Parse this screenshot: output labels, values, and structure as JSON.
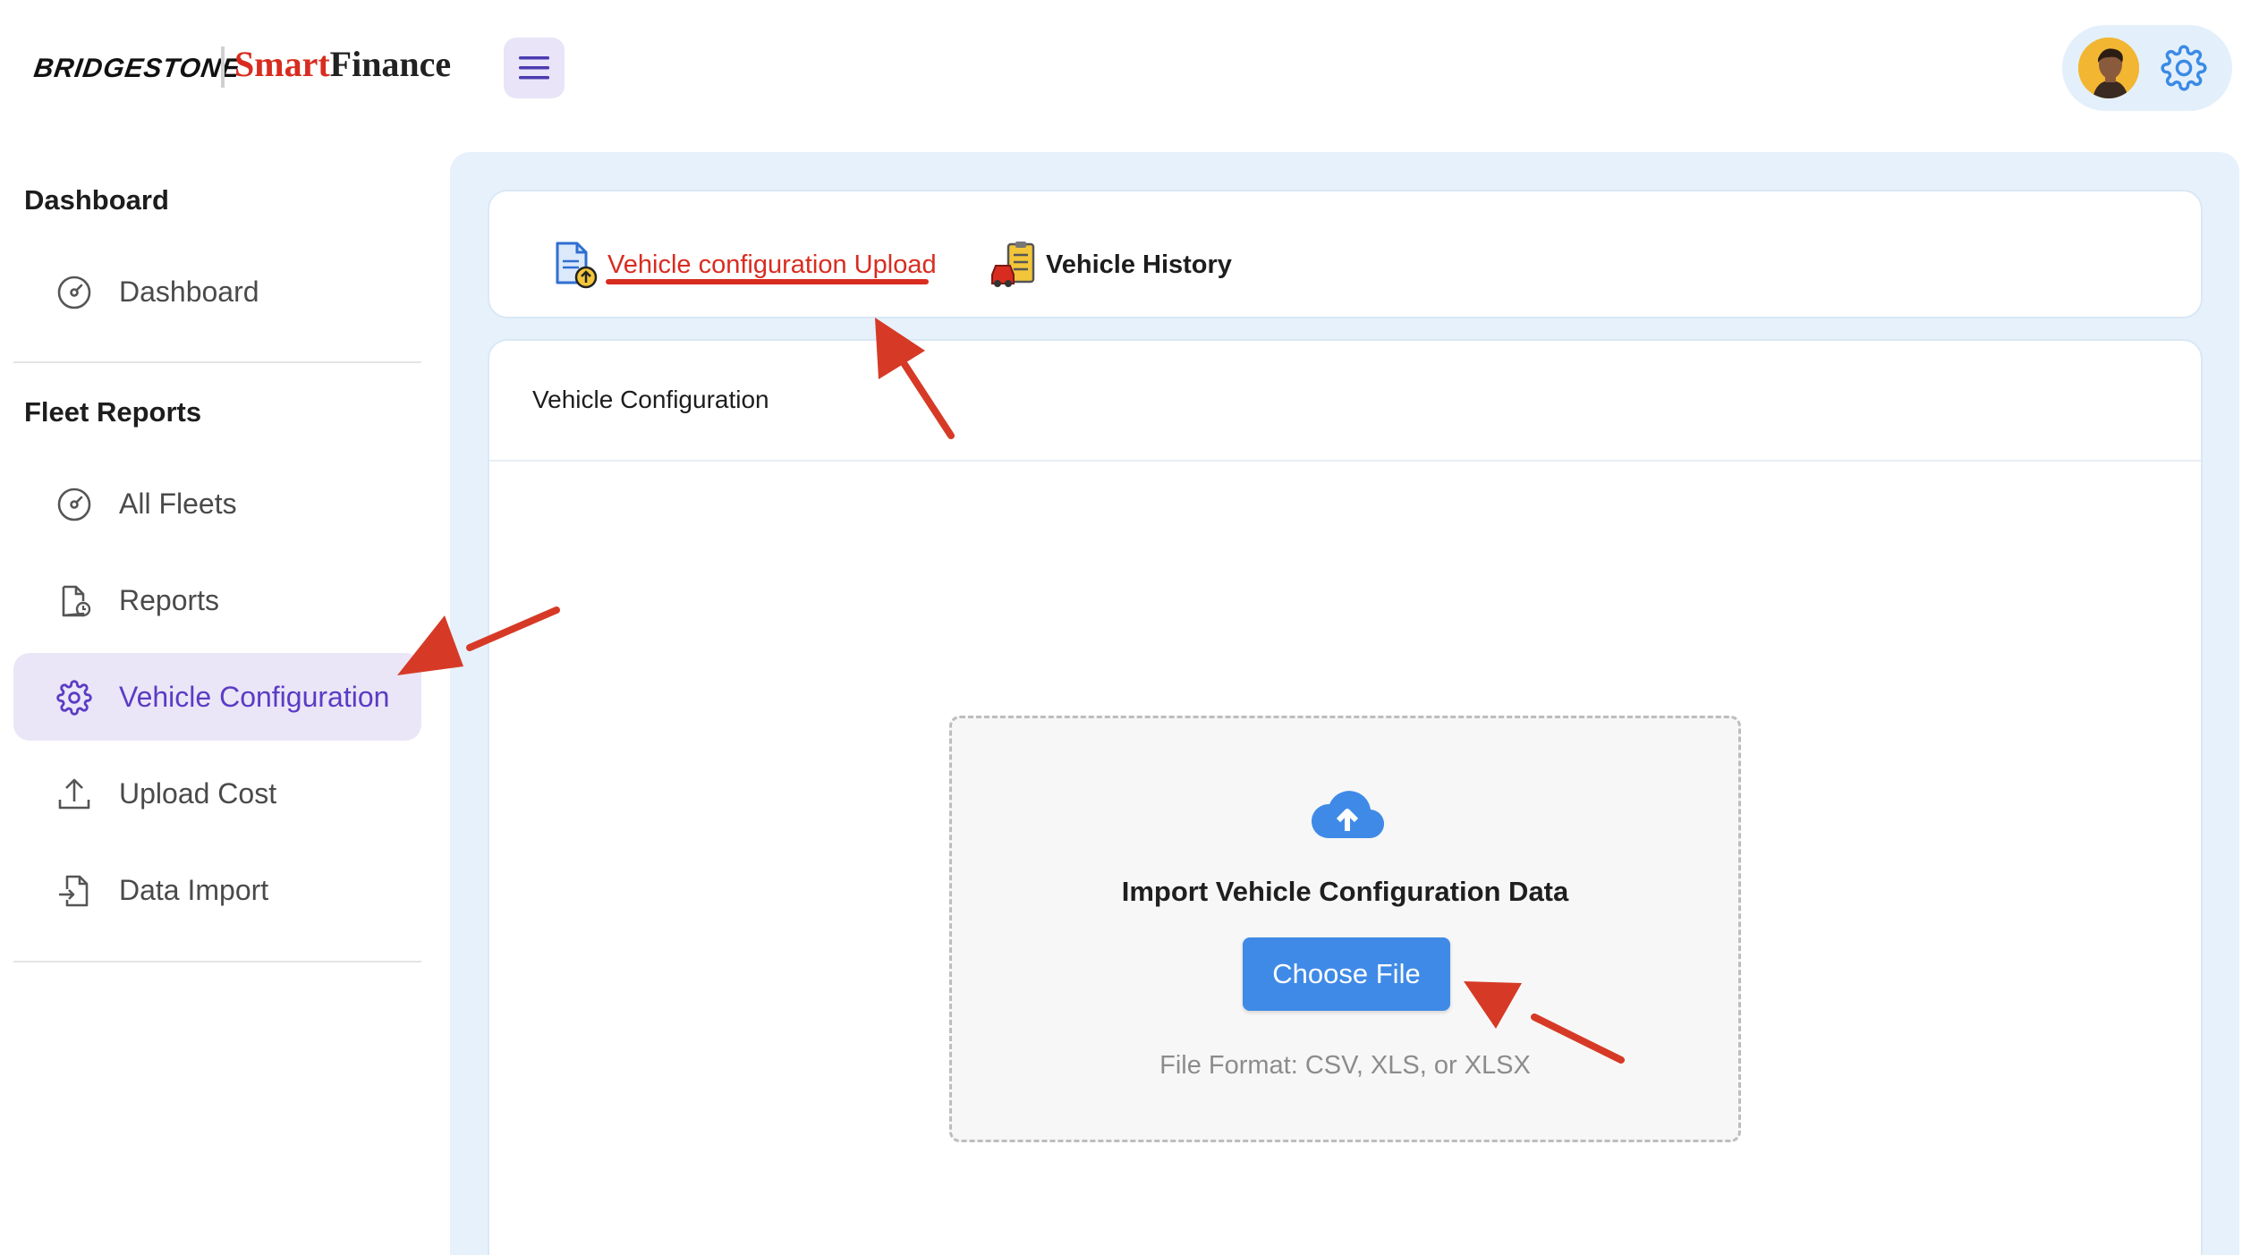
{
  "header": {
    "logo_left": "BRIDGESTONE",
    "logo_right_part1": "Smart",
    "logo_right_part2": "Finance",
    "menu_icon": "hamburger-menu-icon",
    "settings_icon": "gear-icon"
  },
  "sidebar": {
    "section1_title": "Dashboard",
    "section1_items": [
      {
        "label": "Dashboard",
        "icon": "speedometer-icon"
      }
    ],
    "section2_title": "Fleet Reports",
    "section2_items": [
      {
        "label": "All Fleets",
        "icon": "speedometer-icon"
      },
      {
        "label": "Reports",
        "icon": "report-clock-icon"
      },
      {
        "label": "Vehicle Configuration",
        "icon": "gear-icon",
        "active": true
      },
      {
        "label": "Upload Cost",
        "icon": "upload-icon"
      },
      {
        "label": "Data Import",
        "icon": "file-import-icon"
      }
    ]
  },
  "tabs": [
    {
      "label": "Vehicle configuration Upload",
      "icon": "document-upload-icon",
      "active": true
    },
    {
      "label": "Vehicle History",
      "icon": "vehicle-checklist-icon"
    }
  ],
  "content": {
    "title": "Vehicle Configuration",
    "dropzone": {
      "icon": "cloud-upload-icon",
      "title": "Import Vehicle Configuration Data",
      "button_label": "Choose File",
      "hint": "File Format: CSV, XLS, or XLSX"
    }
  },
  "colors": {
    "accent_red": "#d82c20",
    "active_purple": "#5b3cc4",
    "active_bg": "#ebe6f7",
    "main_bg": "#e6f1fb",
    "button_blue": "#3f8ae7",
    "annotation_arrow": "#d63a26"
  }
}
